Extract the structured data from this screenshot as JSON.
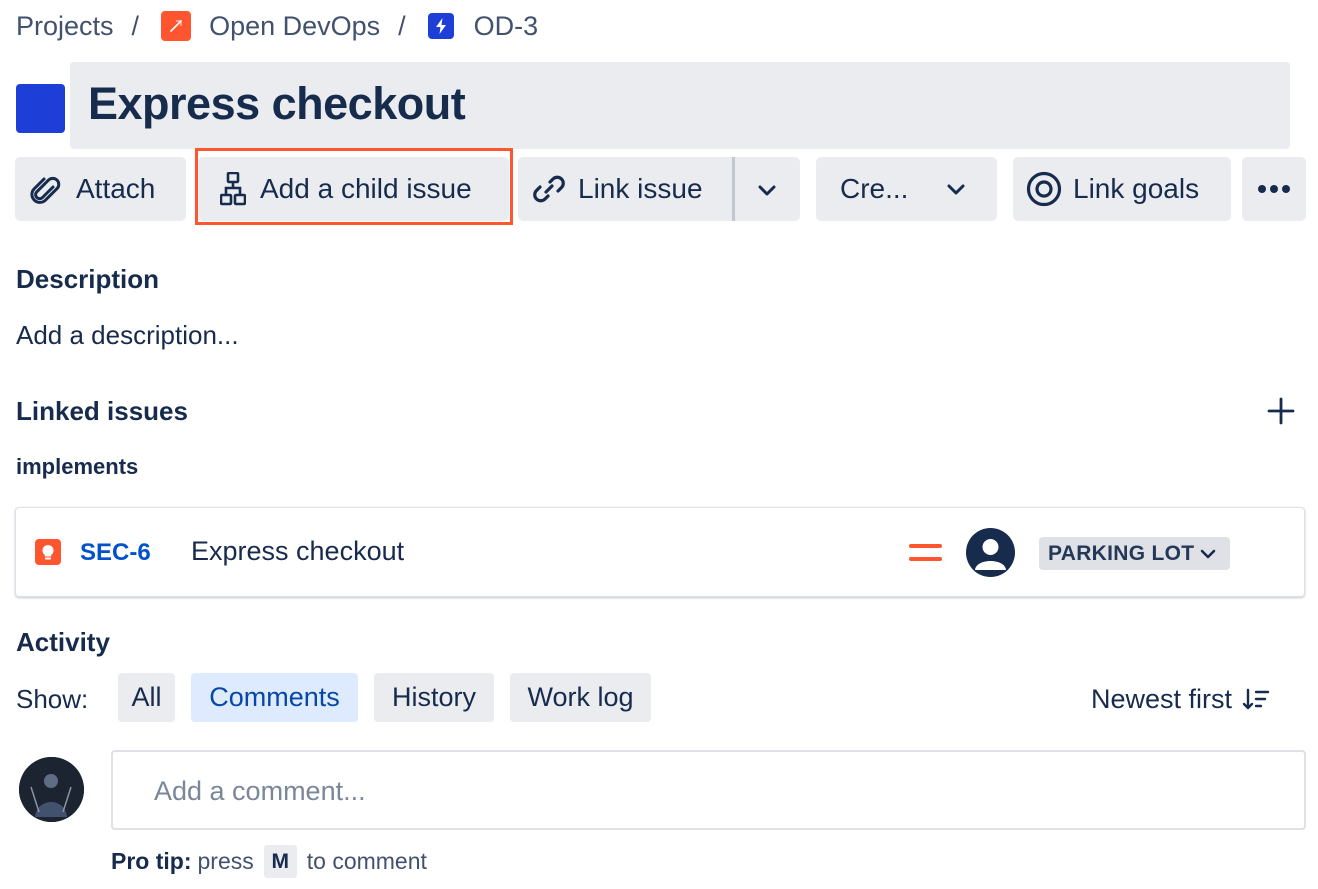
{
  "breadcrumb": {
    "projects": "Projects",
    "separator": "/",
    "project_name": "Open DevOps",
    "issue_key": "OD-3"
  },
  "issue": {
    "title": "Express checkout"
  },
  "toolbar": {
    "attach": "Attach",
    "add_child": "Add a child issue",
    "link_issue": "Link issue",
    "create": "Cre...",
    "link_goals": "Link goals"
  },
  "description": {
    "heading": "Description",
    "placeholder": "Add a description..."
  },
  "linked_issues": {
    "heading": "Linked issues",
    "relation": "implements",
    "items": [
      {
        "key": "SEC-6",
        "summary": "Express checkout",
        "status": "PARKING LOT"
      }
    ]
  },
  "activity": {
    "heading": "Activity",
    "show_label": "Show:",
    "filters": [
      "All",
      "Comments",
      "History",
      "Work log"
    ],
    "active_filter": "Comments",
    "sort": "Newest first",
    "comment_placeholder": "Add a comment...",
    "pro_tip_label": "Pro tip:",
    "pro_tip_press": "press",
    "pro_tip_key": "M",
    "pro_tip_suffix": "to comment"
  },
  "colors": {
    "accent_blue": "#0052CC",
    "epic_blue": "#1D3FD7",
    "highlight_orange": "#FF5630",
    "button_grey": "#EBECF0"
  },
  "icons": [
    "project-icon",
    "lightning-icon",
    "paperclip-icon",
    "hierarchy-icon",
    "link-icon",
    "chevron-down-icon",
    "target-icon",
    "more-icon",
    "plus-icon",
    "lightbulb-icon",
    "priority-medium-icon",
    "user-avatar-icon",
    "sort-icon"
  ]
}
